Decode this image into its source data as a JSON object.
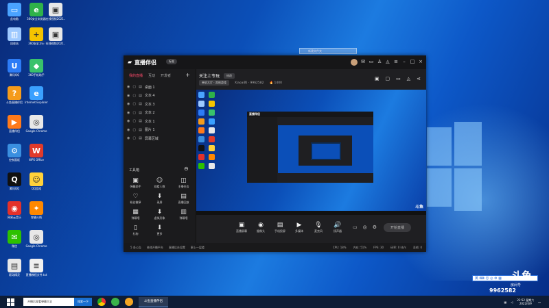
{
  "desktop": {
    "icons": [
      {
        "label": "此电脑",
        "color": "#4aa3ff",
        "glyph": "▭"
      },
      {
        "label": "360安全浏览器",
        "color": "#2fb24a",
        "glyph": "e"
      },
      {
        "label": "在线视频2021..",
        "color": "#e8e8e8",
        "glyph": "▣"
      },
      {
        "label": "回收站",
        "color": "#9ec9ff",
        "glyph": "▥"
      },
      {
        "label": "360安全卫士",
        "color": "#f5c400",
        "glyph": "+"
      },
      {
        "label": "在线视频2021..",
        "color": "#e8e8e8",
        "glyph": "▣"
      },
      {
        "label": "腾讯QQ",
        "color": "#2d7cf6",
        "glyph": "U"
      },
      {
        "label": "360手机助手",
        "color": "#39c26b",
        "glyph": "◆"
      },
      {
        "label": "斗鱼直播伴侣",
        "color": "#f59b1b",
        "glyph": "?"
      },
      {
        "label": "Internet Explorer",
        "color": "#3aa0ff",
        "glyph": "e"
      },
      {
        "label": "直播伴侣",
        "color": "#ff7a1a",
        "glyph": "▶"
      },
      {
        "label": "Google Chrome",
        "color": "#e8e8e8",
        "glyph": "◎"
      },
      {
        "label": "控制面板",
        "color": "#3a8fe0",
        "glyph": "⚙"
      },
      {
        "label": "WPS Office",
        "color": "#e03a2a",
        "glyph": "W"
      },
      {
        "label": "腾讯QQ",
        "color": "#111111",
        "glyph": "Q"
      },
      {
        "label": "QQ游戏",
        "color": "#ffd23a",
        "glyph": "☺"
      },
      {
        "label": "网易云音乐",
        "color": "#e4312a",
        "glyph": "◉"
      },
      {
        "label": "穿越火线",
        "color": "#ff8800",
        "glyph": "✦"
      },
      {
        "label": "微信",
        "color": "#2dc100",
        "glyph": "✉"
      },
      {
        "label": "Google Chrome",
        "color": "#e8e8e8",
        "glyph": "◎"
      },
      {
        "label": "驱动精灵",
        "color": "#e8e8e8",
        "glyph": "▤"
      },
      {
        "label": "直播教程文件.txt",
        "color": "#f0f0f0",
        "glyph": "≡"
      }
    ],
    "selection_label": "新建文件夹"
  },
  "window": {
    "app_title": "直播伴侣",
    "version_badge": "标准",
    "left_tabs": [
      "我的直播",
      "互动",
      "开发者"
    ],
    "add_label": "+",
    "sources": [
      "桌面 1",
      "文本 4",
      "文本 3",
      "文本 2",
      "文本 1",
      "图片 1",
      "屏幕区域"
    ],
    "tools_title": "工具箱",
    "tools": [
      {
        "icon": "▣",
        "label": "弹幕助手"
      },
      {
        "icon": "☺",
        "label": "观看人数"
      },
      {
        "icon": "◫",
        "label": "主播任务"
      },
      {
        "icon": "♡",
        "label": "粉丝徽章"
      },
      {
        "icon": "⬇",
        "label": "录屏"
      },
      {
        "icon": "▤",
        "label": "直播回放"
      },
      {
        "icon": "▦",
        "label": "弹幕墙"
      },
      {
        "icon": "⬇",
        "label": "虚拟形象"
      },
      {
        "icon": "▥",
        "label": "弹幕墙"
      },
      {
        "icon": "▯",
        "label": "礼物"
      },
      {
        "icon": "⬇",
        "label": "更多"
      }
    ],
    "header": {
      "title": "关注上专玩",
      "tag": "修改",
      "category": "单机大厅 · 其他游戏",
      "meta1": "Xiaoai的 · 9962582",
      "meta2": "🔥 1400"
    },
    "preview_mini_title": "直播伴侣",
    "preview_stamp": "斗鱼",
    "controls": [
      {
        "icon": "▣",
        "label": "直播屏幕"
      },
      {
        "icon": "◉",
        "label": "摄像头"
      },
      {
        "icon": "▤",
        "label": "手机投屏"
      },
      {
        "icon": "▶",
        "label": "多媒体"
      },
      {
        "icon": "🎙",
        "label": "麦克风"
      },
      {
        "icon": "🔊",
        "label": "扬声器"
      }
    ],
    "golive_label": "开始直播",
    "status": {
      "left": "5 条公告",
      "items": [
        "修改开播平台",
        "直播后台设置",
        "更上一层楼"
      ],
      "right": [
        "CPU: 18%",
        "内存: 51%",
        "FPS: 30",
        "码率: 0 kb/s",
        "丢帧: 0"
      ]
    }
  },
  "taskbar": {
    "search_text": "开播后观看弹幕大全",
    "search_button": "搜索一下",
    "active_app": "斗鱼直播伴侣",
    "time": "22:52 星期六",
    "date": "2022/4/9"
  },
  "overlay": {
    "bar_text": "英 ⌨ ☺ ◎ ⚙ ▦",
    "big": "斗鱼",
    "room_label": "房间号",
    "room_number": "9962582"
  }
}
